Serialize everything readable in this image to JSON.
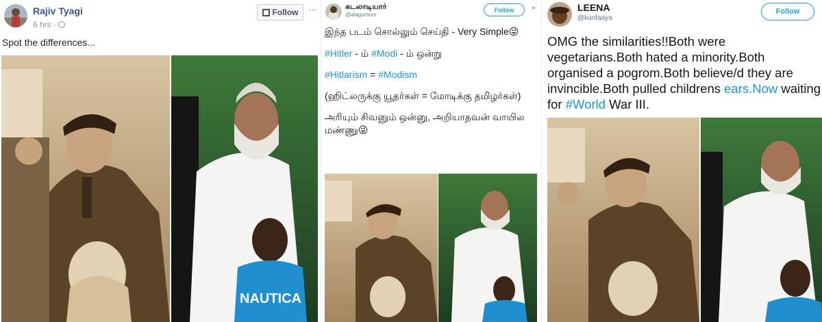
{
  "colors": {
    "fb_link": "#365899",
    "tw_blue": "#1da1f2",
    "tw_link": "#1b95e0",
    "sepia": "#b69a72"
  },
  "facebook_post": {
    "author": "Rajiv Tyagi",
    "time": "6 hrs ·",
    "privacy_icon": "globe-icon",
    "follow_label": "Follow",
    "more_icon": "ellipsis-icon",
    "more_label": "···",
    "text": "Spot the differences...",
    "image_text": "NAUTICA"
  },
  "tweet_tamil": {
    "name": "கடலாடியார்",
    "handle": "@alagumuni",
    "follow_label": "Follow",
    "caret_label": "⌄",
    "line1": "இந்த படம் சொல்லும் செய்தி - Very Simple😜",
    "tags_line1": [
      "#Hitler",
      " - ம் ",
      "#Modi",
      " - ம் ஒன்று"
    ],
    "tags_line2": [
      "#Hitlarism",
      " = ",
      "#Modism"
    ],
    "line3": "(ஹிட்லருக்கு யூதர்கள் = மோடிக்கு தமிழர்கள்)",
    "line4": "அரியும் சிவனும் ஒன்னு, அறியாதவன் வாயில மண்ணு😜"
  },
  "tweet_leena": {
    "name": "LEENA",
    "handle": "@kunfaaya",
    "follow_label": "Follow",
    "text_part1": "OMG the similarities!!Both were vegetarians.Both hated a minority.Both organised a pogrom.Both believe/d they are invincible.Both pulled childrens ",
    "link1": "ears.Now",
    "text_part2": " waiting for ",
    "link2": "#World",
    "text_part3": " War III."
  }
}
